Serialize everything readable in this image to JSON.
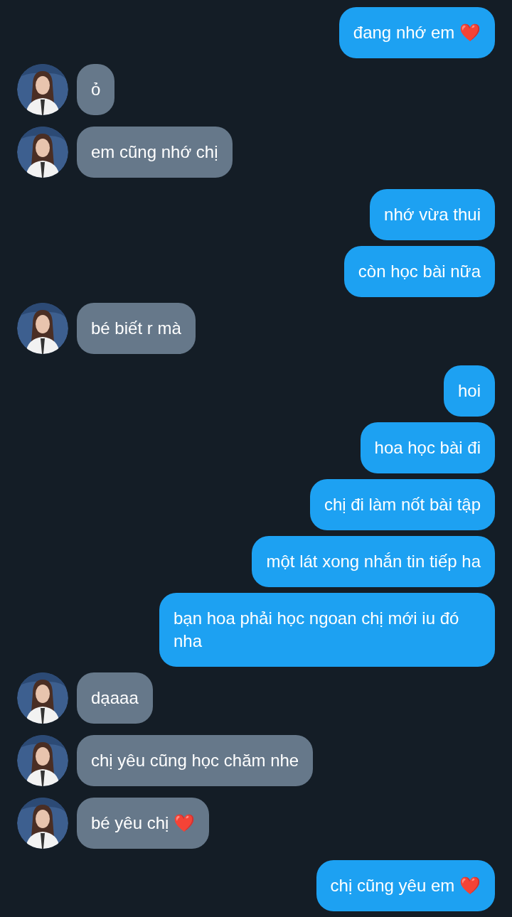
{
  "messages": [
    {
      "kind": "sent",
      "text": "đang nhớ em ❤️"
    },
    {
      "kind": "received",
      "text": "ỏ"
    },
    {
      "kind": "received",
      "text": "em cũng nhớ chị"
    },
    {
      "kind": "sent",
      "text": "nhớ vừa thui"
    },
    {
      "kind": "sent",
      "text": "còn học bài nữa"
    },
    {
      "kind": "received",
      "text": "bé biết r mà"
    },
    {
      "kind": "sent",
      "text": "hoi"
    },
    {
      "kind": "sent",
      "text": "hoa học bài đi"
    },
    {
      "kind": "sent",
      "text": "chị đi làm nốt bài tập"
    },
    {
      "kind": "sent",
      "text": "một lát xong nhắn tin tiếp ha"
    },
    {
      "kind": "sent",
      "text": "bạn hoa phải học ngoan chị mới iu đó nha"
    },
    {
      "kind": "received",
      "text": "dạaaa"
    },
    {
      "kind": "received",
      "text": "chị yêu cũng học chăm nhe"
    },
    {
      "kind": "received",
      "text": "bé yêu chị ❤️"
    },
    {
      "kind": "sent",
      "text": "chị cũng yêu em ❤️"
    }
  ]
}
